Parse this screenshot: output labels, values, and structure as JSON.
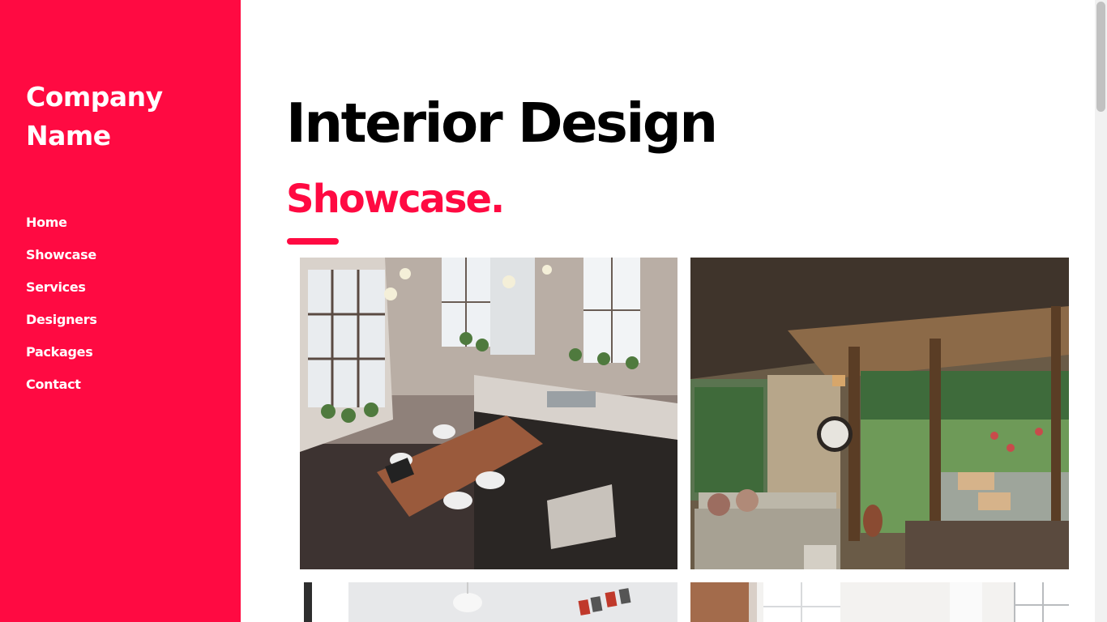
{
  "sidebar": {
    "brand_line1": "Company",
    "brand_line2": "Name",
    "nav": [
      {
        "label": "Home"
      },
      {
        "label": "Showcase"
      },
      {
        "label": "Services"
      },
      {
        "label": "Designers"
      },
      {
        "label": "Packages"
      },
      {
        "label": "Contact"
      }
    ]
  },
  "main": {
    "title": "Interior Design",
    "section_title": "Showcase.",
    "gallery": [
      {
        "name": "loft-kitchen-photo"
      },
      {
        "name": "sunroom-living-photo"
      },
      {
        "name": "white-room-photo"
      },
      {
        "name": "bright-window-room-photo"
      }
    ]
  },
  "colors": {
    "accent": "#ff0a42",
    "sidebar_text": "#ffffff",
    "title_text": "#000000"
  }
}
